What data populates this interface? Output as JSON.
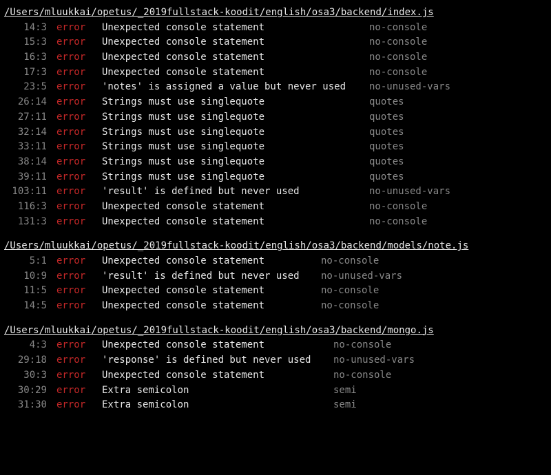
{
  "files": [
    {
      "path": "/Users/mluukkai/opetus/_2019fullstack-koodit/english/osa3/backend/index.js",
      "msgWidth": 370,
      "rows": [
        {
          "line": 14,
          "col": 3,
          "sev": "error",
          "msg": "Unexpected console statement",
          "rule": "no-console"
        },
        {
          "line": 15,
          "col": 3,
          "sev": "error",
          "msg": "Unexpected console statement",
          "rule": "no-console"
        },
        {
          "line": 16,
          "col": 3,
          "sev": "error",
          "msg": "Unexpected console statement",
          "rule": "no-console"
        },
        {
          "line": 17,
          "col": 3,
          "sev": "error",
          "msg": "Unexpected console statement",
          "rule": "no-console"
        },
        {
          "line": 23,
          "col": 5,
          "sev": "error",
          "msg": "'notes' is assigned a value but never used",
          "rule": "no-unused-vars"
        },
        {
          "line": 26,
          "col": 14,
          "sev": "error",
          "msg": "Strings must use singlequote",
          "rule": "quotes"
        },
        {
          "line": 27,
          "col": 11,
          "sev": "error",
          "msg": "Strings must use singlequote",
          "rule": "quotes"
        },
        {
          "line": 32,
          "col": 14,
          "sev": "error",
          "msg": "Strings must use singlequote",
          "rule": "quotes"
        },
        {
          "line": 33,
          "col": 11,
          "sev": "error",
          "msg": "Strings must use singlequote",
          "rule": "quotes"
        },
        {
          "line": 38,
          "col": 14,
          "sev": "error",
          "msg": "Strings must use singlequote",
          "rule": "quotes"
        },
        {
          "line": 39,
          "col": 11,
          "sev": "error",
          "msg": "Strings must use singlequote",
          "rule": "quotes"
        },
        {
          "line": 103,
          "col": 11,
          "sev": "error",
          "msg": "'result' is defined but never used",
          "rule": "no-unused-vars"
        },
        {
          "line": 116,
          "col": 3,
          "sev": "error",
          "msg": "Unexpected console statement",
          "rule": "no-console"
        },
        {
          "line": 131,
          "col": 3,
          "sev": "error",
          "msg": "Unexpected console statement",
          "rule": "no-console"
        }
      ]
    },
    {
      "path": "/Users/mluukkai/opetus/_2019fullstack-koodit/english/osa3/backend/models/note.js",
      "msgWidth": 300,
      "rows": [
        {
          "line": 5,
          "col": 1,
          "sev": "error",
          "msg": "Unexpected console statement",
          "rule": "no-console"
        },
        {
          "line": 10,
          "col": 9,
          "sev": "error",
          "msg": "'result' is defined but never used",
          "rule": "no-unused-vars"
        },
        {
          "line": 11,
          "col": 5,
          "sev": "error",
          "msg": "Unexpected console statement",
          "rule": "no-console"
        },
        {
          "line": 14,
          "col": 5,
          "sev": "error",
          "msg": "Unexpected console statement",
          "rule": "no-console"
        }
      ]
    },
    {
      "path": "/Users/mluukkai/opetus/_2019fullstack-koodit/english/osa3/backend/mongo.js",
      "msgWidth": 318,
      "rows": [
        {
          "line": 4,
          "col": 3,
          "sev": "error",
          "msg": "Unexpected console statement",
          "rule": "no-console"
        },
        {
          "line": 29,
          "col": 18,
          "sev": "error",
          "msg": "'response' is defined but never used",
          "rule": "no-unused-vars"
        },
        {
          "line": 30,
          "col": 3,
          "sev": "error",
          "msg": "Unexpected console statement",
          "rule": "no-console"
        },
        {
          "line": 30,
          "col": 29,
          "sev": "error",
          "msg": "Extra semicolon",
          "rule": "semi"
        },
        {
          "line": 31,
          "col": 30,
          "sev": "error",
          "msg": "Extra semicolon",
          "rule": "semi"
        }
      ]
    }
  ]
}
